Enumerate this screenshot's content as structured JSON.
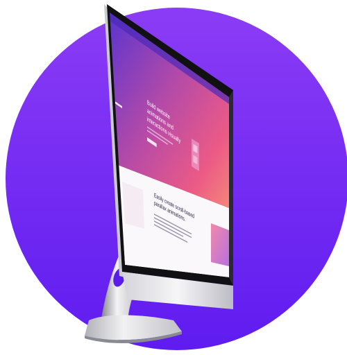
{
  "colors": {
    "circle_top": "#8b3cf5",
    "circle_bottom": "#6a1ef0",
    "screen_hero_top": "#6a3ad8",
    "screen_hero_mid": "#e0508a",
    "screen_hero_bottom": "#f07880",
    "stand_light": "#e8e8ec",
    "stand_dark": "#8a8a92",
    "bezel": "#111114"
  },
  "website": {
    "hero_heading_lines": [
      "Build website",
      "animations and",
      "interactions visually"
    ],
    "section_heading_lines": [
      "Easily create scroll-based",
      "parallax animations."
    ]
  }
}
